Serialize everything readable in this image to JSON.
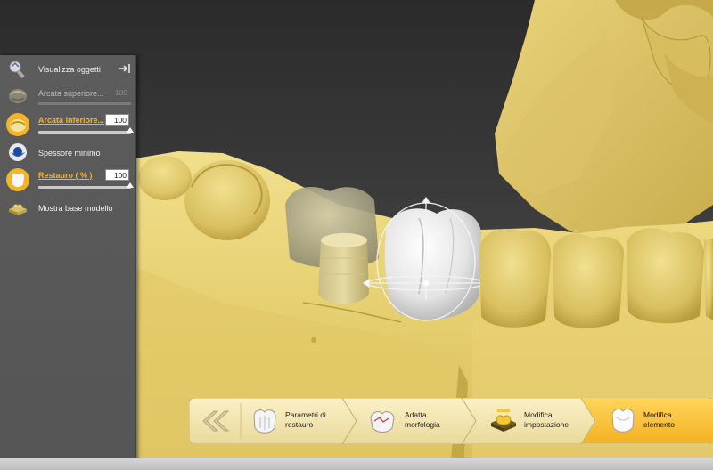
{
  "panel": {
    "title": "Visualizza oggetti",
    "items": [
      {
        "label": "Arcata superiore...",
        "value": "100",
        "state": "dim",
        "icon": "upper-arch-icon"
      },
      {
        "label": "Arcata inferiore...",
        "value": "100",
        "state": "active",
        "icon": "lower-arch-icon"
      },
      {
        "label": "Spessore minimo",
        "icon": "min-thickness-icon"
      },
      {
        "label": "Restauro  ( % )",
        "value": "100",
        "state": "active",
        "icon": "restoration-icon"
      },
      {
        "label": "Mostra base modello",
        "icon": "model-base-icon"
      }
    ]
  },
  "workflow": {
    "back_icon": "double-chevron-left-icon",
    "steps": [
      {
        "line1": "Parametri di",
        "line2": "restauro",
        "icon": "tooth-icon"
      },
      {
        "line1": "Adatta",
        "line2": "morfologia",
        "icon": "morphology-icon"
      },
      {
        "line1": "Modifica",
        "line2": "impostazione",
        "icon": "setup-icon"
      },
      {
        "line1": "Modifica",
        "line2": "elemento",
        "icon": "tooth-icon",
        "active": true
      }
    ]
  },
  "colors": {
    "accent": "#f3b426",
    "model": "#ecd77e",
    "panel": "#5a5a5a",
    "restoration": "#e9e9e9"
  }
}
